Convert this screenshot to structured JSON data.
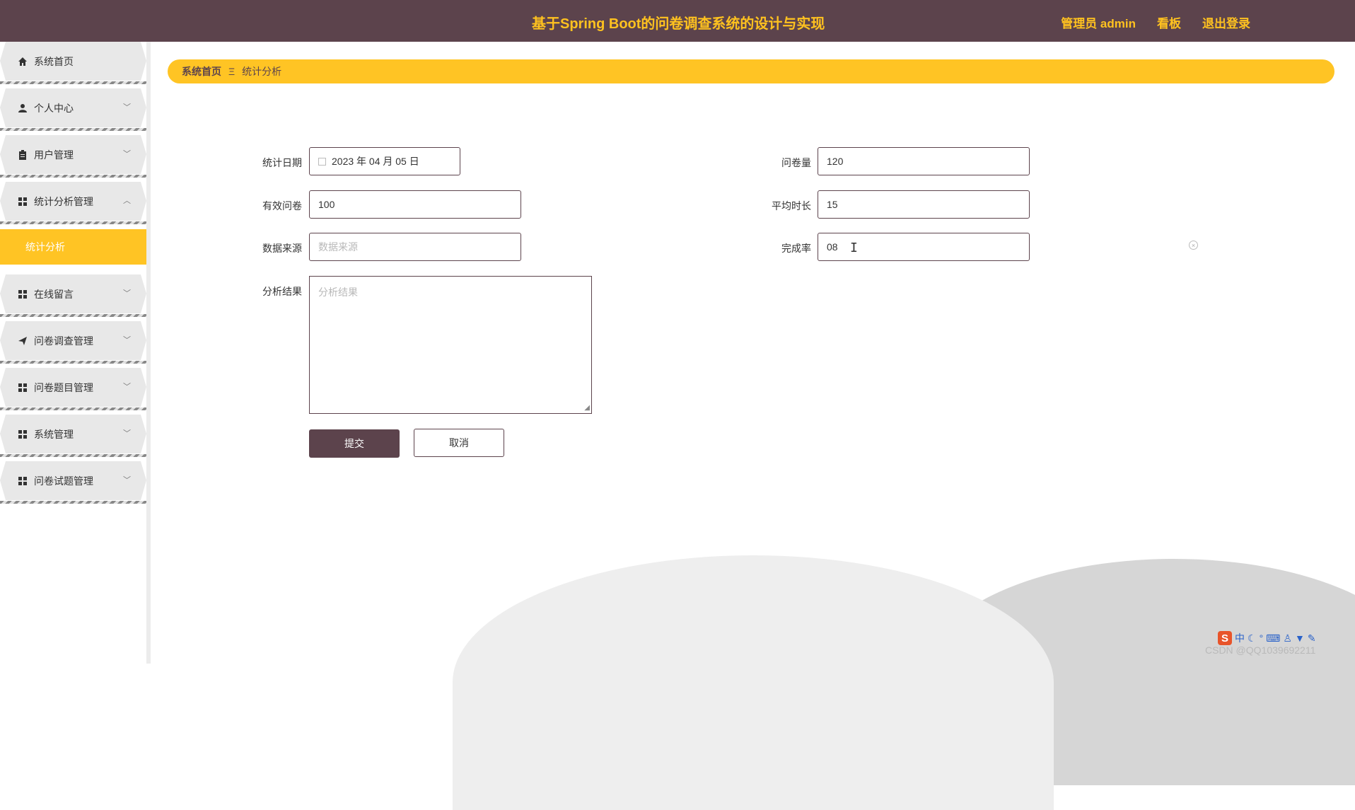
{
  "header": {
    "title": "基于Spring Boot的问卷调查系统的设计与实现",
    "links": [
      "管理员 admin",
      "看板",
      "退出登录"
    ]
  },
  "sidebar": {
    "items": [
      {
        "label": "系统首页",
        "icon": "home-icon"
      },
      {
        "label": "个人中心",
        "icon": "person-icon"
      },
      {
        "label": "用户管理",
        "icon": "clipboard-icon"
      },
      {
        "label": "统计分析管理",
        "icon": "grid-icon"
      },
      {
        "label": "在线留言",
        "icon": "grid-icon"
      },
      {
        "label": "问卷调查管理",
        "icon": "send-icon"
      },
      {
        "label": "问卷题目管理",
        "icon": "grid-icon"
      },
      {
        "label": "系统管理",
        "icon": "grid-icon"
      },
      {
        "label": "问卷试题管理",
        "icon": "grid-icon"
      }
    ],
    "active_sub": "统计分析"
  },
  "breadcrumb": {
    "home": "系统首页",
    "separator": "Ξ",
    "current": "统计分析"
  },
  "form": {
    "stat_date": {
      "label": "统计日期",
      "value": "2023 年 04 月 05 日"
    },
    "survey_count": {
      "label": "问卷量",
      "value": "120"
    },
    "valid_survey": {
      "label": "有效问卷",
      "value": "100"
    },
    "avg_duration": {
      "label": "平均时长",
      "value": "15"
    },
    "data_source": {
      "label": "数据来源",
      "placeholder": "数据来源"
    },
    "completion_rate": {
      "label": "完成率",
      "value": "08"
    },
    "analysis_result": {
      "label": "分析结果",
      "placeholder": "分析结果"
    },
    "submit_label": "提交",
    "cancel_label": "取消"
  },
  "ime": {
    "label": "中"
  },
  "watermark": "CSDN @QQ1039692211",
  "colors": {
    "primary": "#5c434c",
    "accent": "#ffc424"
  }
}
